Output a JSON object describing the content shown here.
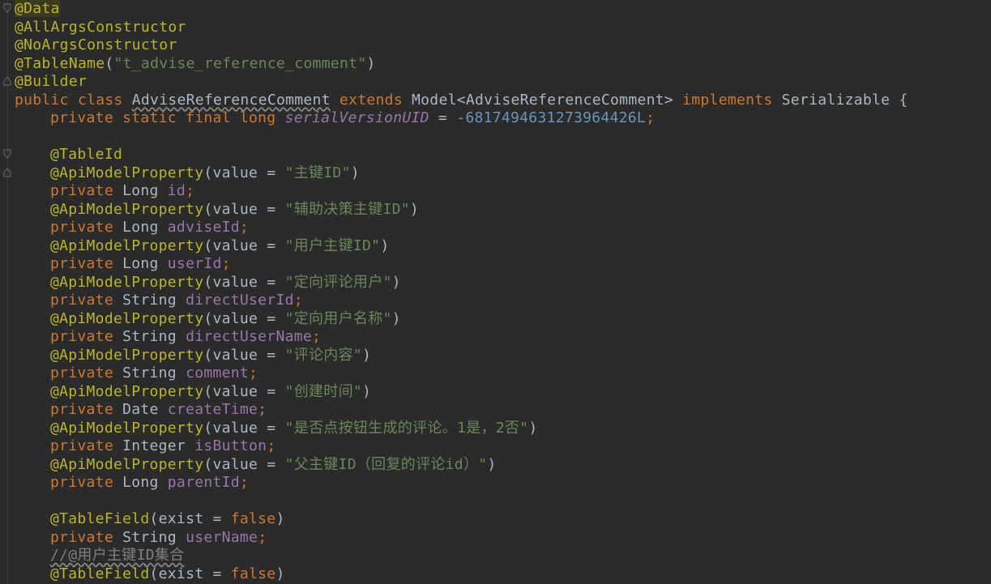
{
  "lines": {
    "l1": "@Data",
    "l2": "@AllArgsConstructor",
    "l3": "@NoArgsConstructor",
    "l4_ann": "@TableName",
    "l4_open": "(",
    "l4_str": "\"t_advise_reference_comment\"",
    "l4_close": ")",
    "l5": "@Builder",
    "l6_kw1": "public class ",
    "l6_name": "AdviseReferenceComment",
    "l6_kw2": " extends ",
    "l6_mid": "Model<AdviseReferenceComment> ",
    "l6_kw3": "implements ",
    "l6_end": "Serializable {",
    "l7_kw": "private static final long ",
    "l7_field": "serialVersionUID",
    "l7_eq": " = ",
    "l7_num": "-6817494631273964426L",
    "l7_semi": ";",
    "l9": "@TableId",
    "props": [
      {
        "ann": "@ApiModelProperty",
        "param": "(value = ",
        "str": "\"主键ID\"",
        "close": ")",
        "kw": "private ",
        "type": "Long ",
        "field": "id",
        "semi": ";"
      },
      {
        "ann": "@ApiModelProperty",
        "param": "(value = ",
        "str": "\"辅助决策主键ID\"",
        "close": ")",
        "kw": "private ",
        "type": "Long ",
        "field": "adviseId",
        "semi": ";"
      },
      {
        "ann": "@ApiModelProperty",
        "param": "(value = ",
        "str": "\"用户主键ID\"",
        "close": ")",
        "kw": "private ",
        "type": "Long ",
        "field": "userId",
        "semi": ";"
      },
      {
        "ann": "@ApiModelProperty",
        "param": "(value = ",
        "str": "\"定向评论用户\"",
        "close": ")",
        "kw": "private ",
        "type": "String ",
        "field": "directUserId",
        "semi": ";"
      },
      {
        "ann": "@ApiModelProperty",
        "param": "(value = ",
        "str": "\"定向用户名称\"",
        "close": ")",
        "kw": "private ",
        "type": "String ",
        "field": "directUserName",
        "semi": ";"
      },
      {
        "ann": "@ApiModelProperty",
        "param": "(value = ",
        "str": "\"评论内容\"",
        "close": ")",
        "kw": "private ",
        "type": "String ",
        "field": "comment",
        "semi": ";"
      },
      {
        "ann": "@ApiModelProperty",
        "param": "(value = ",
        "str": "\"创建时间\"",
        "close": ")",
        "kw": "private ",
        "type": "Date ",
        "field": "createTime",
        "semi": ";"
      },
      {
        "ann": "@ApiModelProperty",
        "param": "(value = ",
        "str": "\"是否点按钮生成的评论。1是，2否\"",
        "close": ")",
        "kw": "private ",
        "type": "Integer ",
        "field": "isButton",
        "semi": ";"
      },
      {
        "ann": "@ApiModelProperty",
        "param": "(value = ",
        "str": "\"父主键ID（回复的评论id）\"",
        "close": ")",
        "kw": "private ",
        "type": "Long ",
        "field": "parentId",
        "semi": ";"
      }
    ],
    "tf1_ann": "@TableField",
    "tf1_param": "(exist = ",
    "tf1_kw": "false",
    "tf1_close": ")",
    "un_kw": "private ",
    "un_type": "String ",
    "un_field": "userName",
    "un_semi": ";",
    "comment": "//@用户主键ID集合",
    "tf2_ann": "@TableField",
    "tf2_param": "(exist = ",
    "tf2_kw": "false",
    "tf2_close": ")"
  }
}
